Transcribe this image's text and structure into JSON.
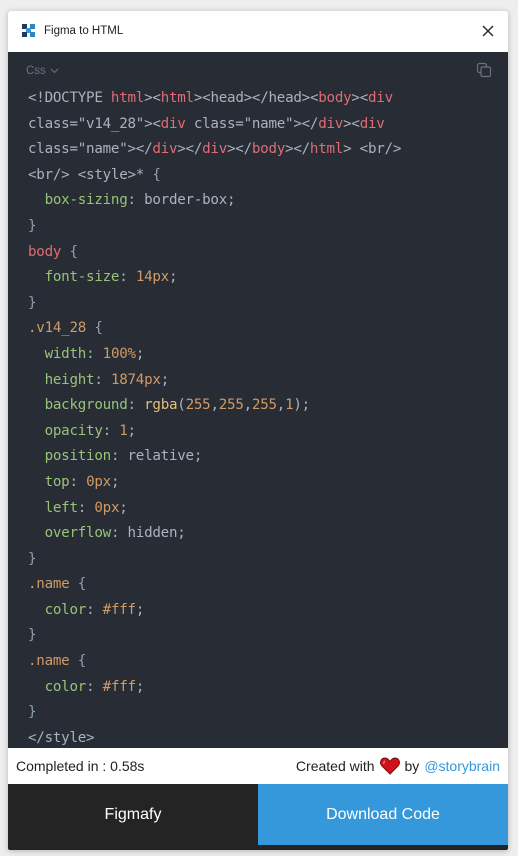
{
  "window": {
    "title": "Figma to HTML",
    "logo_icon": "figma-to-html-logo",
    "close_icon": "close-icon"
  },
  "code_panel": {
    "language": "Css",
    "language_icon": "chevron-down-icon",
    "copy_icon": "copy-icon",
    "background_color": "#282c34",
    "lines": [
      [
        [
          "plain",
          "<!DOCTYPE "
        ],
        [
          "tag",
          "html"
        ],
        [
          "plain",
          "><"
        ],
        [
          "tag",
          "html"
        ],
        [
          "plain",
          "><head></head><"
        ],
        [
          "tag",
          "body"
        ],
        [
          "plain",
          "><"
        ],
        [
          "tag",
          "div"
        ]
      ],
      [
        [
          "plain",
          "class=\"v14_28\"><"
        ],
        [
          "tag",
          "div"
        ],
        [
          "plain",
          " class=\"name\"></"
        ],
        [
          "tag",
          "div"
        ],
        [
          "plain",
          "><"
        ],
        [
          "tag",
          "div"
        ]
      ],
      [
        [
          "plain",
          "class=\"name\"></"
        ],
        [
          "tag",
          "div"
        ],
        [
          "plain",
          "></"
        ],
        [
          "tag",
          "div"
        ],
        [
          "plain",
          "></"
        ],
        [
          "tag",
          "body"
        ],
        [
          "plain",
          "></"
        ],
        [
          "tag",
          "html"
        ],
        [
          "plain",
          "> <br/>"
        ]
      ],
      [
        [
          "plain",
          "<br/> <style>* "
        ],
        [
          "brace",
          "{"
        ]
      ],
      [
        [
          "plain",
          "  "
        ],
        [
          "prop",
          "box-sizing"
        ],
        [
          "plain",
          ": border-box;"
        ]
      ],
      [
        [
          "brace",
          "}"
        ]
      ],
      [
        [
          "tag",
          "body"
        ],
        [
          "plain",
          " "
        ],
        [
          "brace",
          "{"
        ]
      ],
      [
        [
          "plain",
          "  "
        ],
        [
          "prop",
          "font-size"
        ],
        [
          "plain",
          ": "
        ],
        [
          "num",
          "14px"
        ],
        [
          "plain",
          ";"
        ]
      ],
      [
        [
          "brace",
          "}"
        ]
      ],
      [
        [
          "sel",
          ".v14_28"
        ],
        [
          "plain",
          " "
        ],
        [
          "brace",
          "{"
        ]
      ],
      [
        [
          "plain",
          "  "
        ],
        [
          "prop",
          "width"
        ],
        [
          "plain",
          ": "
        ],
        [
          "num",
          "100%"
        ],
        [
          "plain",
          ";"
        ]
      ],
      [
        [
          "plain",
          "  "
        ],
        [
          "prop",
          "height"
        ],
        [
          "plain",
          ": "
        ],
        [
          "num",
          "1874px"
        ],
        [
          "plain",
          ";"
        ]
      ],
      [
        [
          "plain",
          "  "
        ],
        [
          "prop",
          "background"
        ],
        [
          "plain",
          ": "
        ],
        [
          "fn",
          "rgba"
        ],
        [
          "plain",
          "("
        ],
        [
          "num",
          "255"
        ],
        [
          "plain",
          ","
        ],
        [
          "num",
          "255"
        ],
        [
          "plain",
          ","
        ],
        [
          "num",
          "255"
        ],
        [
          "plain",
          ","
        ],
        [
          "num",
          "1"
        ],
        [
          "plain",
          ");"
        ]
      ],
      [
        [
          "plain",
          "  "
        ],
        [
          "prop",
          "opacity"
        ],
        [
          "plain",
          ": "
        ],
        [
          "num",
          "1"
        ],
        [
          "plain",
          ";"
        ]
      ],
      [
        [
          "plain",
          "  "
        ],
        [
          "prop",
          "position"
        ],
        [
          "plain",
          ": relative;"
        ]
      ],
      [
        [
          "plain",
          "  "
        ],
        [
          "prop",
          "top"
        ],
        [
          "plain",
          ": "
        ],
        [
          "num",
          "0px"
        ],
        [
          "plain",
          ";"
        ]
      ],
      [
        [
          "plain",
          "  "
        ],
        [
          "prop",
          "left"
        ],
        [
          "plain",
          ": "
        ],
        [
          "num",
          "0px"
        ],
        [
          "plain",
          ";"
        ]
      ],
      [
        [
          "plain",
          "  "
        ],
        [
          "prop",
          "overflow"
        ],
        [
          "plain",
          ": hidden;"
        ]
      ],
      [
        [
          "brace",
          "}"
        ]
      ],
      [
        [
          "sel",
          ".name"
        ],
        [
          "plain",
          " "
        ],
        [
          "brace",
          "{"
        ]
      ],
      [
        [
          "plain",
          "  "
        ],
        [
          "prop",
          "color"
        ],
        [
          "plain",
          ": "
        ],
        [
          "num",
          "#fff"
        ],
        [
          "plain",
          ";"
        ]
      ],
      [
        [
          "brace",
          "}"
        ]
      ],
      [
        [
          "sel",
          ".name"
        ],
        [
          "plain",
          " "
        ],
        [
          "brace",
          "{"
        ]
      ],
      [
        [
          "plain",
          "  "
        ],
        [
          "prop",
          "color"
        ],
        [
          "plain",
          ": "
        ],
        [
          "num",
          "#fff"
        ],
        [
          "plain",
          ";"
        ]
      ],
      [
        [
          "brace",
          "}"
        ]
      ],
      [
        [
          "plain",
          "</style>"
        ]
      ]
    ]
  },
  "status_bar": {
    "completed_text": "Completed in : 0.58s",
    "created_with": "Created with",
    "heart_icon": "heart-icon",
    "by": "by",
    "author_link": "@storybrain",
    "link_color": "#3498db"
  },
  "actions": {
    "figmafy_label": "Figmafy",
    "download_label": "Download Code",
    "figmafy_color": "#242424",
    "download_color": "#3498db"
  }
}
